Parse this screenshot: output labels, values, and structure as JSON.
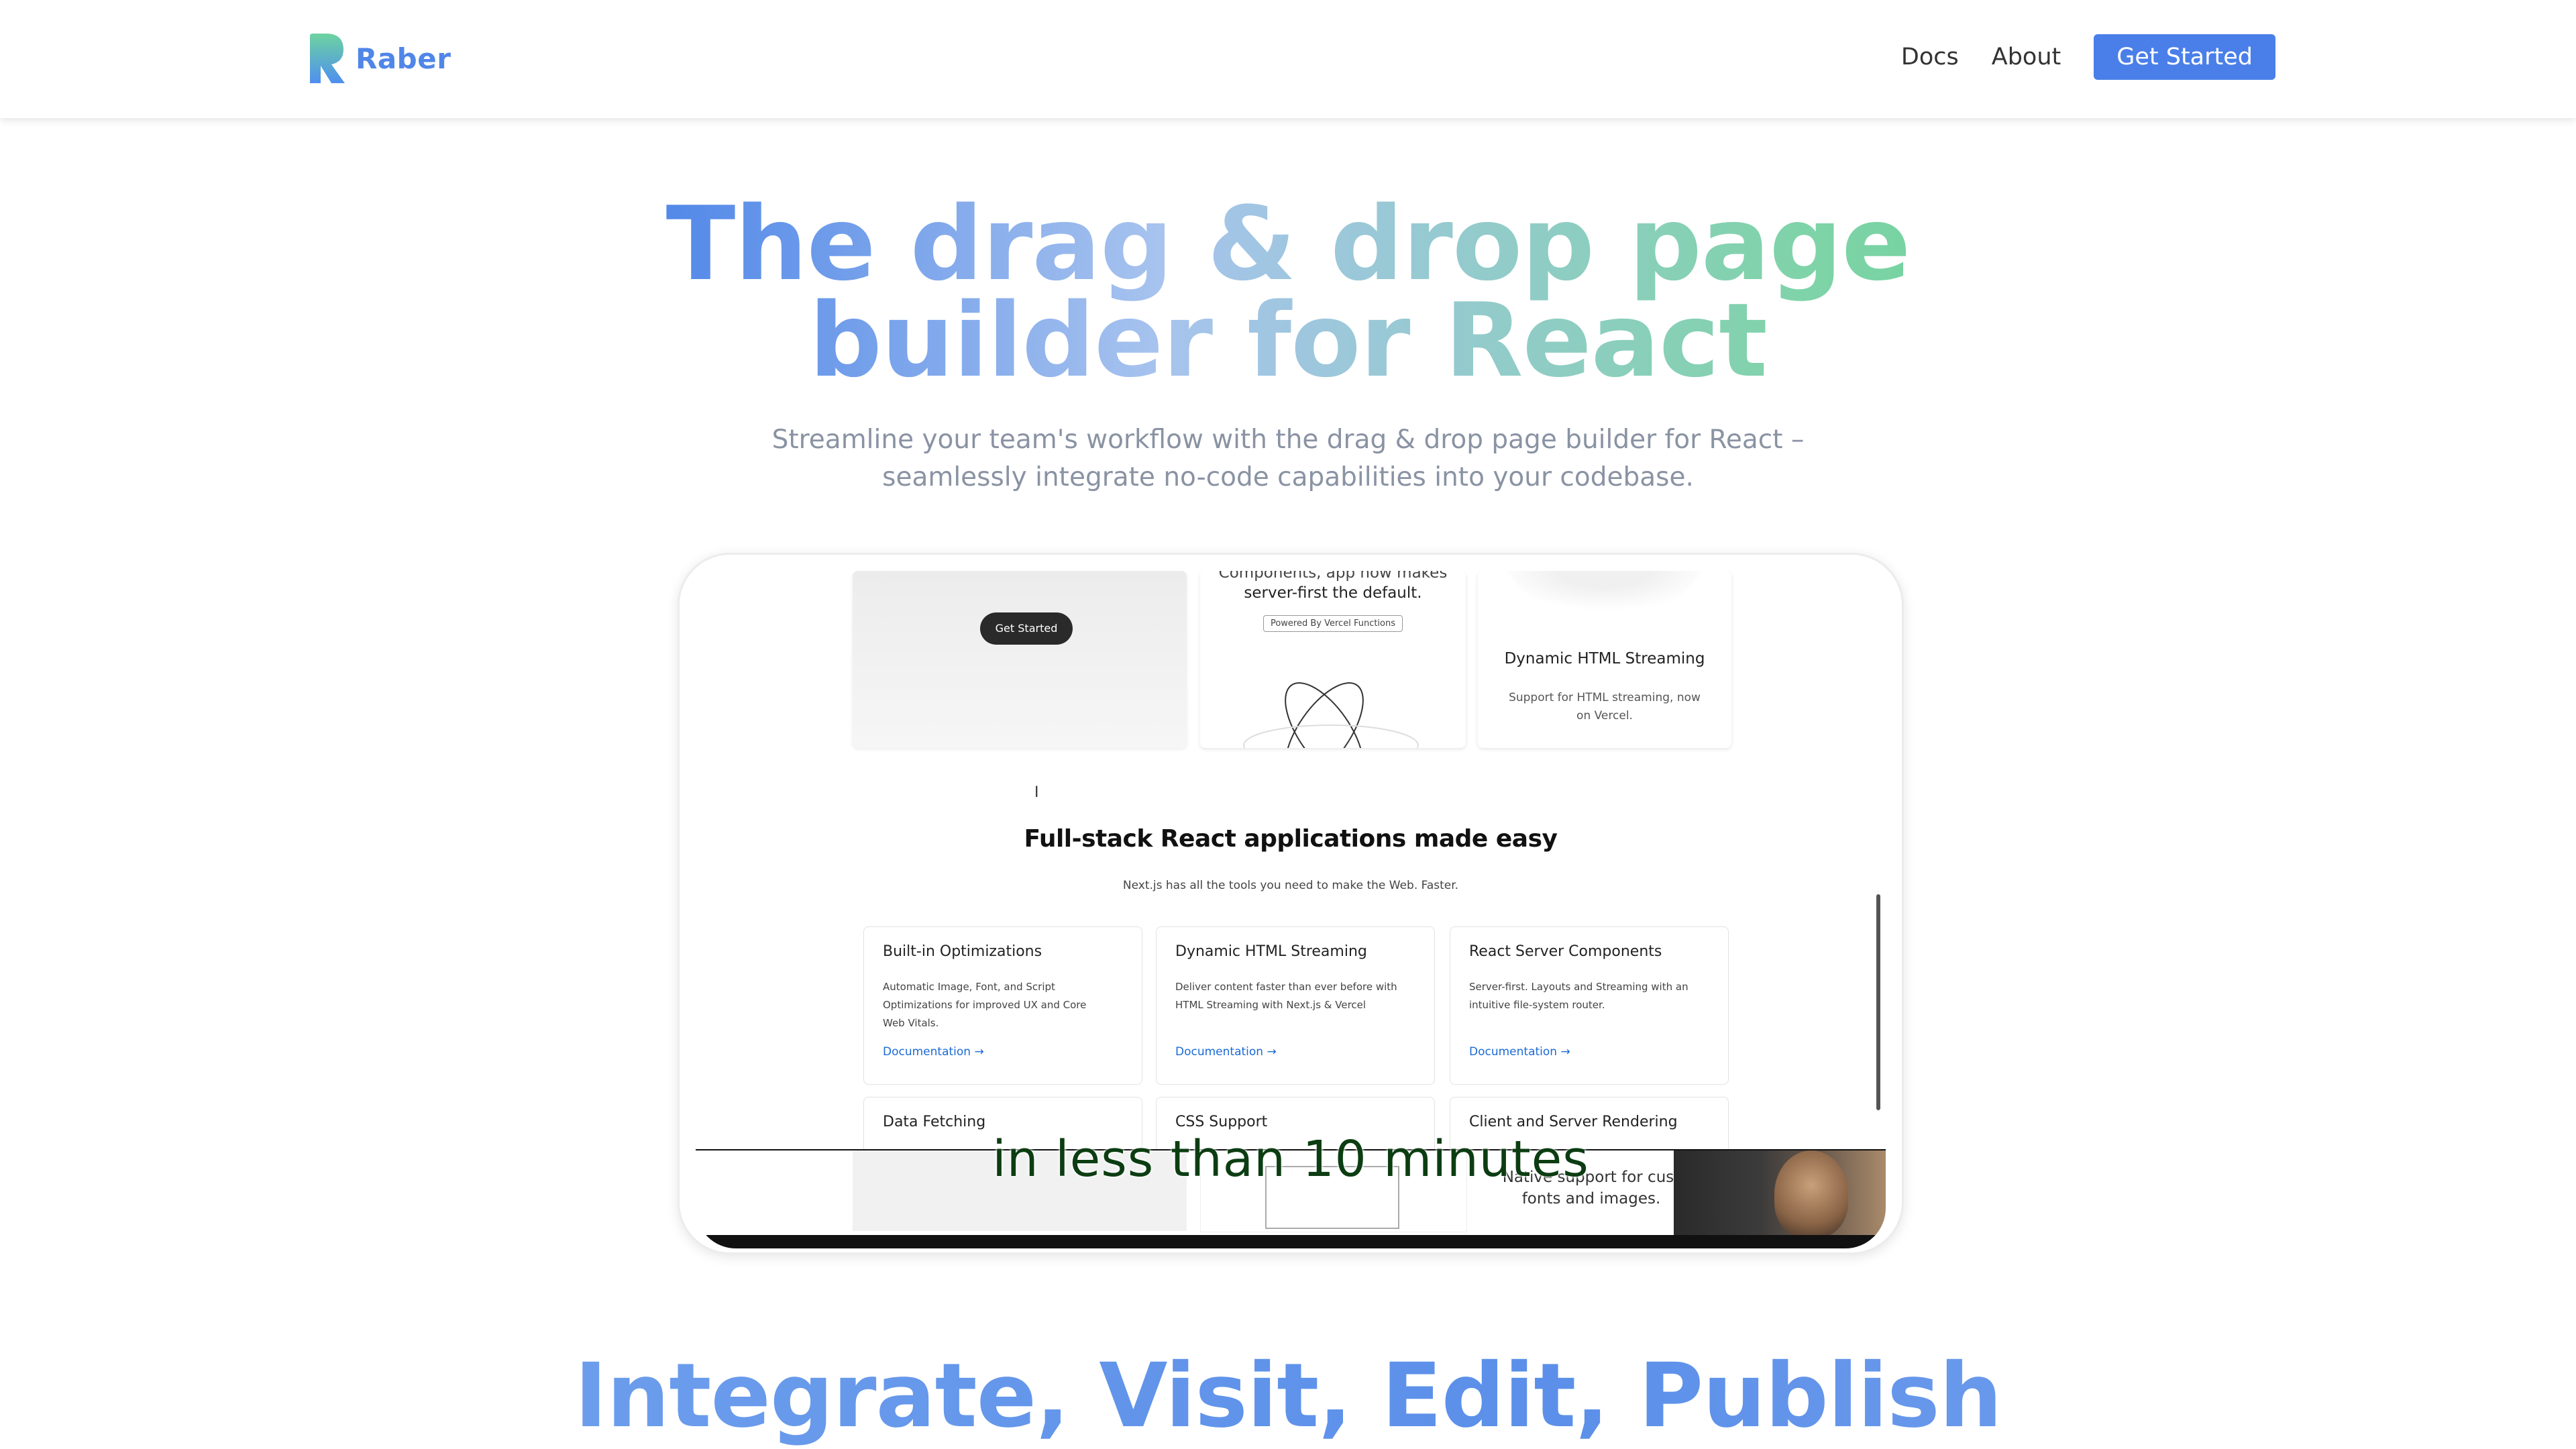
{
  "brand": {
    "name": "Raber",
    "accent": "#4f86e8"
  },
  "nav": {
    "docs": "Docs",
    "about": "About",
    "cta": "Get Started"
  },
  "hero": {
    "title_line1": "The drag & drop page",
    "title_line2": "builder for React",
    "subtitle_line1": "Streamline your team's workflow with the drag & drop page builder for React –",
    "subtitle_line2": "seamlessly integrate no-code capabilities into your codebase."
  },
  "video": {
    "top_card_button": "Get Started",
    "server_card": {
      "line1": "Components, app now makes",
      "line2": "server-first the default.",
      "badge": "Powered By Vercel Functions"
    },
    "streaming_card": {
      "title": "Dynamic HTML Streaming",
      "desc": "Support for HTML streaming, now on Vercel."
    },
    "section_title": "Full-stack React applications made easy",
    "section_sub": "Next.js has all the tools you need to make the Web. Faster.",
    "features": [
      {
        "title": "Built-in Optimizations",
        "desc": "Automatic Image, Font, and Script Optimizations for improved UX and Core Web Vitals.",
        "link": "Documentation →"
      },
      {
        "title": "Dynamic HTML Streaming",
        "desc": "Deliver content faster than ever before with HTML Streaming with Next.js & Vercel",
        "link": "Documentation →"
      },
      {
        "title": "React Server Components",
        "desc": "Server-first. Layouts and Streaming with an intuitive file-system router.",
        "link": "Documentation →"
      }
    ],
    "features_row2": [
      {
        "title": "Data Fetching"
      },
      {
        "title": "CSS Support"
      },
      {
        "title": "Client and Server Rendering"
      }
    ],
    "native_text": "Native support for cust fonts and images.",
    "caption": "in less than 10 minutes"
  },
  "next_section": {
    "title": "Integrate, Visit, Edit, Publish"
  }
}
